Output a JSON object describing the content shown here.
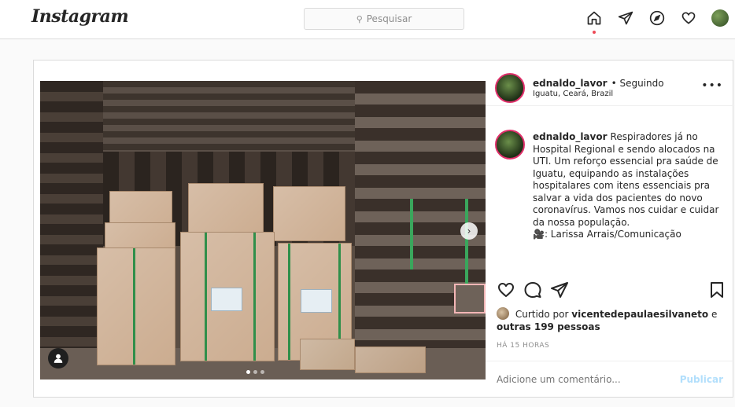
{
  "topbar": {
    "logo": "Instagram",
    "search_placeholder": "Pesquisar",
    "nav": [
      "home-icon",
      "direct-icon",
      "explore-icon",
      "activity-icon",
      "profile-avatar"
    ]
  },
  "post": {
    "author": {
      "username": "ednaldo_lavor",
      "follow_status": "• Seguindo",
      "location": "Iguatu, Ceará, Brazil"
    },
    "caption": {
      "username": "ednaldo_lavor",
      "text": "Respiradores já no Hospital Regional e sendo alocados na UTI. Um reforço essencial pra saúde de Iguatu, equipando as instalações hospitalares com itens essenciais pra salvar a vida dos pacientes do novo coronavírus. Vamos nos cuidar e cuidar da nossa população.",
      "credit": "🎥: Larissa Arrais/Comunicação"
    },
    "likes": {
      "prefix": "Curtido por",
      "liker": "vicentedepaulaesilvaneto",
      "conjunction": "e",
      "others": "outras 199 pessoas"
    },
    "timestamp": "HÁ 15 HORAS",
    "comment": {
      "placeholder": "Adicione um comentário...",
      "publish_label": "Publicar"
    },
    "carousel": {
      "total": 3,
      "active_index": 0
    }
  },
  "colors": {
    "accent": "#b2dffc",
    "notification": "#ed4956",
    "story_ring": "#e1306c",
    "strap": "#2f8f4a"
  }
}
